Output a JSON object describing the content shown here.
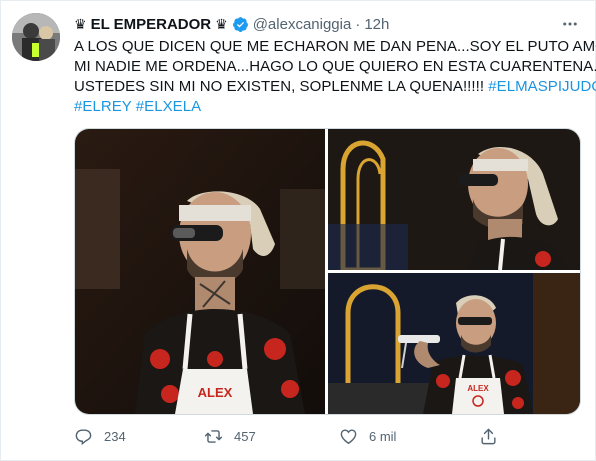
{
  "author": {
    "display_name": "EL EMPERADOR",
    "crown_left": "♛",
    "crown_right": "♛",
    "handle": "@alexcaniggia",
    "separator": "·",
    "time": "12h",
    "verified": true
  },
  "tweet": {
    "line1": "A LOS QUE DICEN QUE ME ECHARON ME DAN PENA...SOY EL PUTO AMO A",
    "line2": "MI NADIE ME ORDENA...HAGO LO QUE QUIERO EN ESTA CUARENTENA...",
    "line3_text": "USTEDES SIN MI NO EXISTEN, SOPLENME LA QUENA!!!!! ",
    "hashtag1": "#ELMASPIJUDO",
    "hashtag2": "#ELREY",
    "hashtag3": "#ELXELA"
  },
  "media": {
    "photo1_apron_text": "ALEX",
    "photo3_apron_text": "ALEX"
  },
  "actions": {
    "replies": "234",
    "retweets": "457",
    "likes": "6 mil"
  },
  "colors": {
    "link": "#1b95e0",
    "verified": "#1d9bf0",
    "eggplant": "#7b3fa0",
    "muted": "#536471"
  },
  "icons": [
    "more-icon",
    "verified-badge-icon",
    "eggplant-emoji-icon",
    "reply-icon",
    "retweet-icon",
    "like-icon",
    "share-icon"
  ]
}
